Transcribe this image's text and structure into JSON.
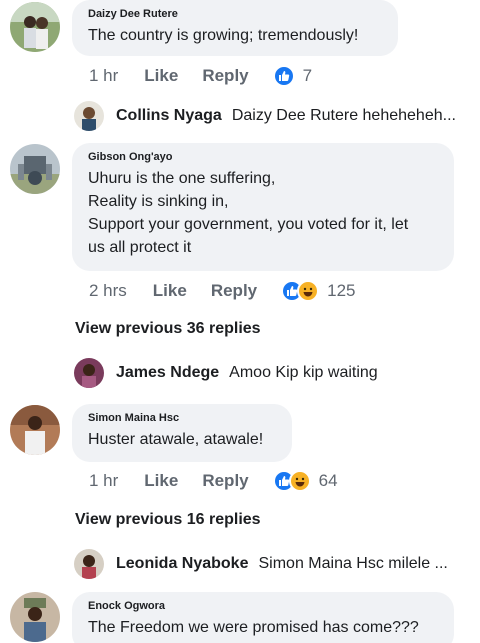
{
  "comments": [
    {
      "author": "Daizy Dee Rutere",
      "lines": [
        "The country is growing; tremendously!"
      ],
      "time": "1 hr",
      "like_label": "Like",
      "reply_label": "Reply",
      "reactions": [
        "like"
      ],
      "reaction_count": "7"
    },
    {
      "author": "Gibson Ong'ayo",
      "lines": [
        "Uhuru is the one suffering,",
        "Reality is sinking in,",
        "Support your government,  you voted for it, let",
        "us all protect it"
      ],
      "time": "2 hrs",
      "like_label": "Like",
      "reply_label": "Reply",
      "reactions": [
        "like",
        "haha"
      ],
      "reaction_count": "125"
    },
    {
      "author": "Simon Maina Hsc",
      "lines": [
        "Huster atawale, atawale!"
      ],
      "time": "1 hr",
      "like_label": "Like",
      "reply_label": "Reply",
      "reactions": [
        "like",
        "haha"
      ],
      "reaction_count": "64"
    },
    {
      "author": "Enock Ogwora",
      "lines": [
        "The Freedom we were promised has come???"
      ]
    }
  ],
  "replies": [
    {
      "name": "Collins Nyaga",
      "text": "Daizy Dee Rutere heheheheh..."
    },
    {
      "name": "James Ndege",
      "text": "Amoo Kip kip waiting"
    },
    {
      "name": "Leonida Nyaboke",
      "text": "Simon Maina Hsc milele ..."
    }
  ],
  "view_previous": [
    "View previous 36 replies",
    "View previous 16 replies"
  ],
  "colors": {
    "bubble": "#f0f2f5",
    "like_blue": "#1877f2",
    "haha_yellow": "#f7b125",
    "meta_gray": "#606770"
  }
}
